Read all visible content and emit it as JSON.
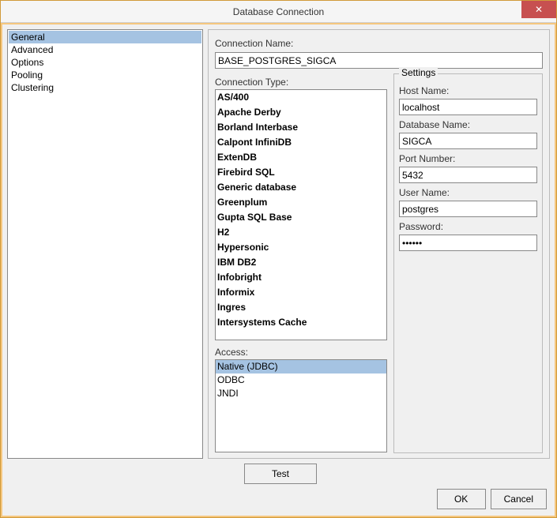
{
  "window": {
    "title": "Database Connection"
  },
  "sidebar": {
    "items": [
      {
        "label": "General",
        "selected": true
      },
      {
        "label": "Advanced",
        "selected": false
      },
      {
        "label": "Options",
        "selected": false
      },
      {
        "label": "Pooling",
        "selected": false
      },
      {
        "label": "Clustering",
        "selected": false
      }
    ]
  },
  "connection_name": {
    "label": "Connection Name:",
    "value": "BASE_POSTGRES_SIGCA"
  },
  "connection_type": {
    "label": "Connection Type:",
    "items": [
      "AS/400",
      "Apache Derby",
      "Borland Interbase",
      "Calpont InfiniDB",
      "ExtenDB",
      "Firebird SQL",
      "Generic database",
      "Greenplum",
      "Gupta SQL Base",
      "H2",
      "Hypersonic",
      "IBM DB2",
      "Infobright",
      "Informix",
      "Ingres",
      "Intersystems Cache"
    ]
  },
  "access": {
    "label": "Access:",
    "items": [
      {
        "label": "Native (JDBC)",
        "selected": true
      },
      {
        "label": "ODBC",
        "selected": false
      },
      {
        "label": "JNDI",
        "selected": false
      }
    ]
  },
  "settings": {
    "legend": "Settings",
    "host_name": {
      "label": "Host Name:",
      "value": "localhost"
    },
    "database_name": {
      "label": "Database Name:",
      "value": "SIGCA"
    },
    "port_number": {
      "label": "Port Number:",
      "value": "5432"
    },
    "user_name": {
      "label": "User Name:",
      "value": "postgres"
    },
    "password": {
      "label": "Password:",
      "value": "••••••"
    }
  },
  "buttons": {
    "test": "Test",
    "ok": "OK",
    "cancel": "Cancel"
  }
}
